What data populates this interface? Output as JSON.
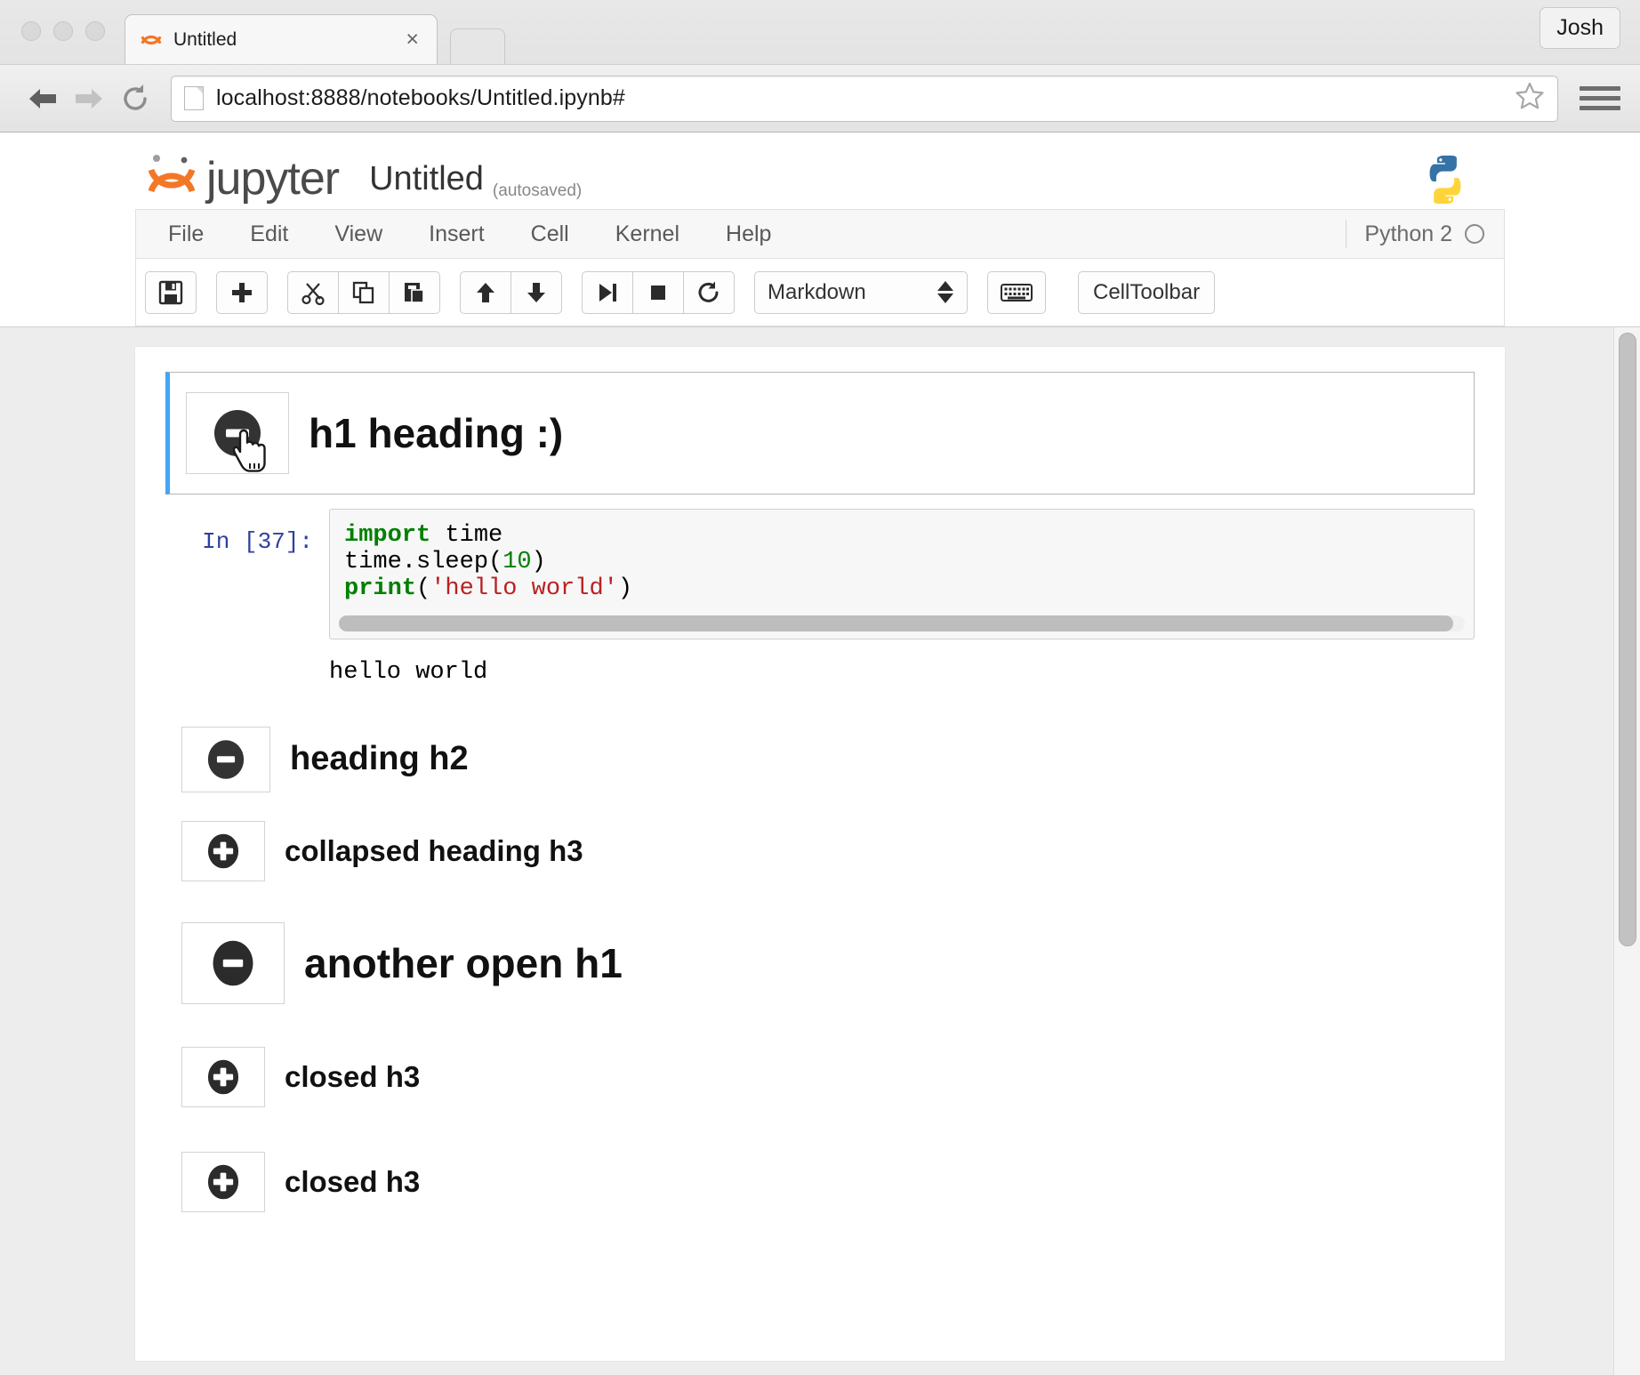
{
  "browser": {
    "tab": {
      "title": "Untitled",
      "favicon": "jupyter-favicon",
      "close_label": "×"
    },
    "profile_button": "Josh",
    "url": {
      "scheme_host": "localhost",
      "port": ":8888",
      "path": "/notebooks/Untitled.ipynb#",
      "full": "localhost:8888/notebooks/Untitled.ipynb#"
    },
    "nav": {
      "back": "back-arrow",
      "forward": "forward-arrow",
      "reload": "reload-arrow"
    },
    "bookmark_icon": "star-icon",
    "app_menu_icon": "hamburger-menu-icon"
  },
  "jupyter": {
    "logo_text": "jupyter",
    "notebook_name": "Untitled",
    "save_state": "(autosaved)",
    "kernel_logo": "python-logo",
    "menubar": [
      {
        "label": "File"
      },
      {
        "label": "Edit"
      },
      {
        "label": "View"
      },
      {
        "label": "Insert"
      },
      {
        "label": "Cell"
      },
      {
        "label": "Kernel"
      },
      {
        "label": "Help"
      }
    ],
    "kernel": {
      "name": "Python 2",
      "status_icon": "kernel-idle-circle"
    },
    "toolbar": {
      "groups": [
        {
          "buttons": [
            {
              "name": "save-icon",
              "title": "Save"
            }
          ]
        },
        {
          "buttons": [
            {
              "name": "add-cell-icon",
              "title": "Insert cell below"
            }
          ]
        },
        {
          "buttons": [
            {
              "name": "scissors-icon",
              "title": "Cut cell"
            },
            {
              "name": "copy-icon",
              "title": "Copy cell"
            },
            {
              "name": "paste-icon",
              "title": "Paste cell"
            }
          ]
        },
        {
          "buttons": [
            {
              "name": "arrow-up-icon",
              "title": "Move cell up"
            },
            {
              "name": "arrow-down-icon",
              "title": "Move cell down"
            }
          ]
        },
        {
          "buttons": [
            {
              "name": "run-icon",
              "title": "Run cell"
            },
            {
              "name": "stop-icon",
              "title": "Interrupt kernel"
            },
            {
              "name": "restart-icon",
              "title": "Restart kernel"
            }
          ]
        }
      ],
      "cell_type_select": {
        "value": "Markdown",
        "spinner_icon": "spinner-arrows-icon"
      },
      "keyboard_button": {
        "icon": "keyboard-icon"
      },
      "cell_toolbar_button": {
        "label": "CellToolbar"
      }
    }
  },
  "notebook": {
    "cells": [
      {
        "kind": "heading",
        "level": 1,
        "selected": true,
        "toggle": "minus",
        "toggle_name": "collapse-toggle-minus",
        "text": "h1 heading :)",
        "cursor": "pointing-hand-cursor"
      },
      {
        "kind": "code",
        "prompt": "In [37]:",
        "lines": [
          [
            {
              "t": "import",
              "c": "kw"
            },
            {
              "t": " time",
              "c": ""
            }
          ],
          [
            {
              "t": "time.sleep(",
              "c": ""
            },
            {
              "t": "10",
              "c": "num"
            },
            {
              "t": ")",
              "c": ""
            }
          ],
          [
            {
              "t": "print",
              "c": "kw"
            },
            {
              "t": "(",
              "c": ""
            },
            {
              "t": "'hello world'",
              "c": "str"
            },
            {
              "t": ")",
              "c": ""
            }
          ]
        ],
        "has_hscrollbar": true,
        "output": "hello world"
      },
      {
        "kind": "heading",
        "level": 2,
        "selected": false,
        "toggle": "minus",
        "toggle_name": "collapse-toggle-minus",
        "text": "heading h2"
      },
      {
        "kind": "heading",
        "level": 3,
        "selected": false,
        "toggle": "plus",
        "toggle_name": "expand-toggle-plus",
        "text": "collapsed heading h3"
      },
      {
        "kind": "heading",
        "level": 1,
        "selected": false,
        "toggle": "minus",
        "toggle_name": "collapse-toggle-minus",
        "text": "another open h1"
      },
      {
        "kind": "heading",
        "level": 3,
        "selected": false,
        "toggle": "plus",
        "toggle_name": "expand-toggle-plus",
        "text": "closed h3"
      },
      {
        "kind": "heading",
        "level": 3,
        "selected": false,
        "toggle": "plus",
        "toggle_name": "expand-toggle-plus",
        "text": "closed h3"
      }
    ]
  },
  "colors": {
    "accent_selected_cell": "#42a5f5",
    "jupyter_orange": "#f37726",
    "kernel_prompt_blue": "#303f9f",
    "code_keyword_green": "#008000",
    "code_string_red": "#ba2121",
    "python_blue": "#3572A5",
    "python_yellow": "#FFD43B"
  }
}
